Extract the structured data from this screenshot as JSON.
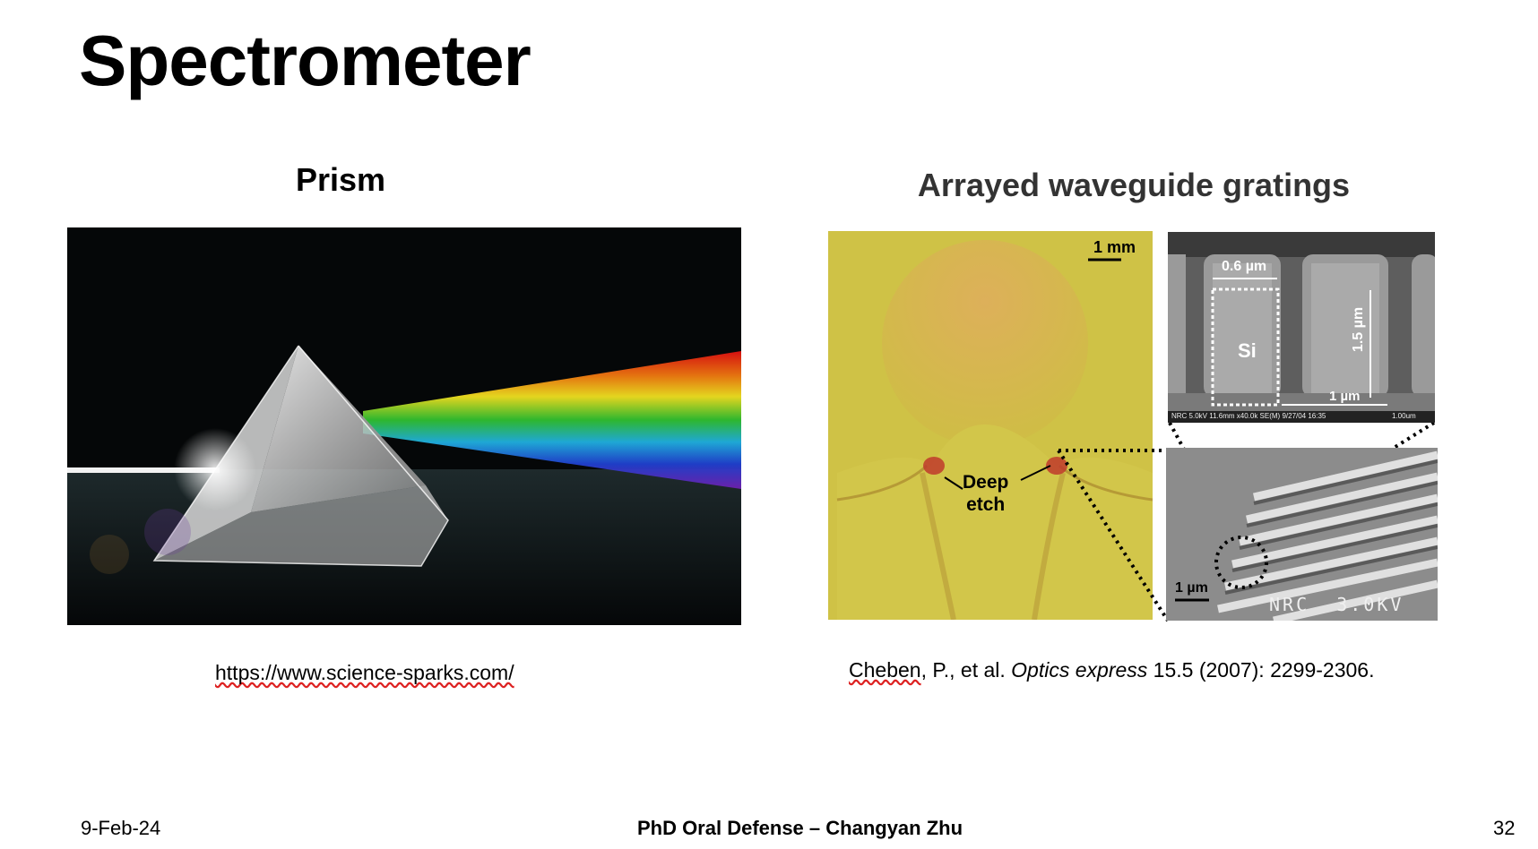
{
  "slide": {
    "title": "Spectrometer",
    "left": {
      "heading": "Prism",
      "caption": "https://www.science-sparks.com/"
    },
    "right": {
      "heading": "Arrayed waveguide gratings",
      "figure": {
        "scale_bar": "1 mm",
        "deep_etch_line1": "Deep",
        "deep_etch_line2": "etch",
        "sem_width_label": "0.6 µm",
        "sem_core_label": "Si",
        "sem_height_label": "1.5 µm",
        "sem_bottom_label": "1 µm",
        "sem_info": "NRC 5.0kV 11.6mm x40.0k SE(M) 9/27/04 16:35",
        "sem_scale": "1.00um",
        "sem2_scale": "1 µm",
        "sem2_info": "NRC  3.0KV"
      },
      "citation": {
        "author": "Cheben",
        "rest1": ", P., et al. ",
        "journal": "Optics express",
        "rest2": " 15.5 (2007): 2299-2306."
      }
    },
    "footer": {
      "date": "9-Feb-24",
      "center": "PhD Oral Defense – Changyan Zhu",
      "page": "32"
    }
  },
  "colors": {
    "awg_background": "#d6c94a",
    "prism_background": "#050708"
  }
}
